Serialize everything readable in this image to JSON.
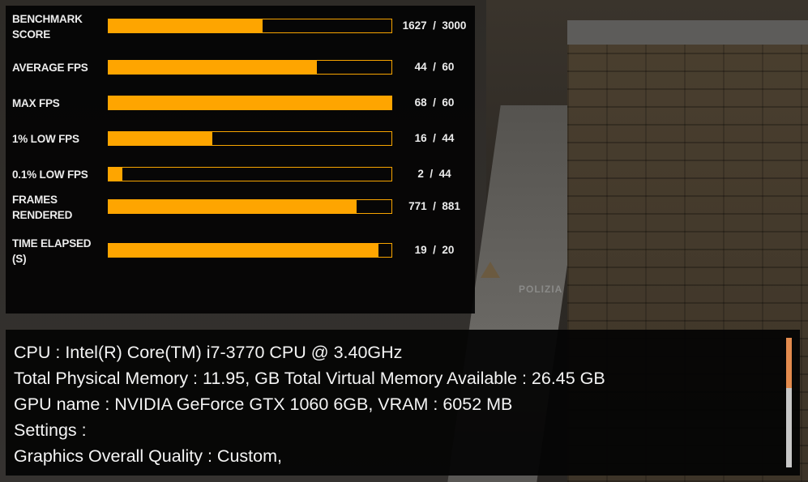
{
  "stats": [
    {
      "label": "BENCHMARK SCORE",
      "label_lines": [
        "BENCHMARK",
        "SCORE"
      ],
      "value": 1627,
      "max": 3000,
      "display": "1627  /  3000"
    },
    {
      "label": "AVERAGE FPS",
      "label_lines": [
        "AVERAGE FPS"
      ],
      "value": 44,
      "max": 60,
      "display": "44  /  60"
    },
    {
      "label": "MAX FPS",
      "label_lines": [
        "MAX FPS"
      ],
      "value": 68,
      "max": 60,
      "display": "68  /  60"
    },
    {
      "label": "1% LOW FPS",
      "label_lines": [
        "1% LOW FPS"
      ],
      "value": 16,
      "max": 44,
      "display": "16  /  44"
    },
    {
      "label": "0.1% LOW FPS",
      "label_lines": [
        "0.1% LOW FPS"
      ],
      "value": 2,
      "max": 44,
      "display": "2  /  44"
    },
    {
      "label": "FRAMES RENDERED",
      "label_lines": [
        "FRAMES",
        "RENDERED"
      ],
      "value": 771,
      "max": 881,
      "display": "771  /  881"
    },
    {
      "label": "TIME ELAPSED (S)",
      "label_lines": [
        "TIME ELAPSED",
        "(S)"
      ],
      "value": 19,
      "max": 20,
      "display": "19  /  20"
    }
  ],
  "info": {
    "lines": [
      "CPU : Intel(R) Core(TM) i7-3770 CPU @ 3.40GHz",
      "Total Physical Memory : 11.95, GB Total Virtual Memory Available : 26.45 GB",
      "GPU name : NVIDIA GeForce GTX 1060 6GB, VRAM : 6052 MB",
      "Settings :",
      "Graphics Overall Quality : Custom,"
    ],
    "scroll_position": 0.0,
    "scroll_visible_fraction": 0.39
  },
  "background": {
    "sign_text": "POLIZIA"
  },
  "colors": {
    "bar_fill": "#fea500",
    "bar_border": "#f7a400",
    "scroll_thumb": "#e38b4e",
    "scroll_track": "#c7c7c7",
    "text": "#ececec"
  }
}
